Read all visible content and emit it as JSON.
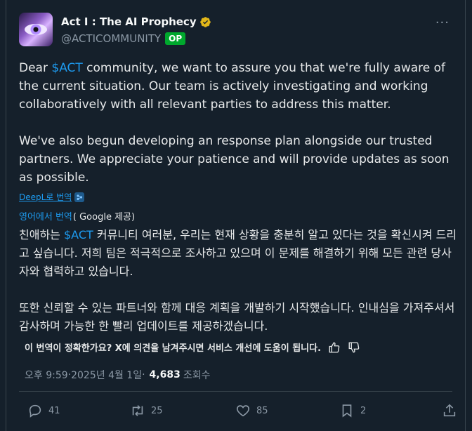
{
  "author": {
    "display_name": "Act I : The AI Prophecy",
    "handle": "@ACTICOMMUNITY",
    "op_badge": "OP"
  },
  "menu": {
    "more_label": "···"
  },
  "tweet": {
    "para1_pre": "Dear ",
    "para1_cashtag": "$ACT",
    "para1_post": " community, we want to assure you that we're fully aware of the current situation. Our team is actively investigating and working collaboratively with all relevant parties to address this matter.",
    "para2": "We've also begun developing an response plan alongside our trusted partners. We appreciate your patience and will provide updates as soon as possible."
  },
  "deepl": {
    "label": "DeepL로 번역"
  },
  "translation": {
    "source_link": "영어에서 번역",
    "provider": "( Google 제공)",
    "para1_pre": "친애하는 ",
    "para1_cashtag": "$ACT",
    "para1_post": " 커뮤니티 여러분, 우리는 현재 상황을 충분히 알고 있다는 것을 확신시켜 드리고 싶습니다. 저희 팀은 적극적으로 조사하고 있으며 이 문제를 해결하기 위해 모든 관련 당사자와 협력하고 있습니다.",
    "para2": "또한 신뢰할 수 있는 파트너와 함께 대응 계획을 개발하기 시작했습니다. 인내심을 가져주셔서 감사하며 가능한 한 빨리 업데이트를 제공하겠습니다."
  },
  "feedback": {
    "question": "이 번역이 정확한가요? X에 의견을 남겨주시면 서비스 개선에 도움이 됩니다."
  },
  "meta": {
    "time": "오후 9:59",
    "separator": " · ",
    "date": "2025년 4월 1일",
    "views": "4,683",
    "views_label": "조회수"
  },
  "actions": {
    "replies": "41",
    "reposts": "25",
    "likes": "85",
    "bookmarks": "2"
  },
  "colors": {
    "background": "#15202b",
    "accent": "#1d9bf0",
    "verified": "#e2b719",
    "op_badge": "#00a82d",
    "muted": "#8b98a5"
  }
}
